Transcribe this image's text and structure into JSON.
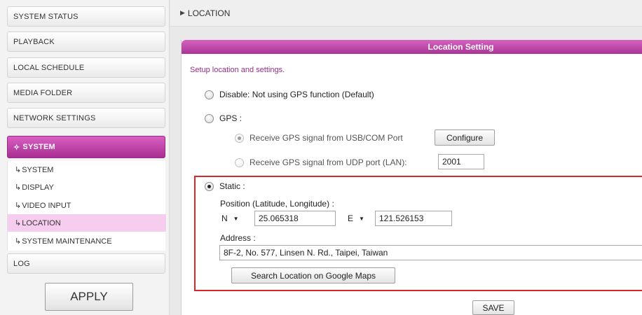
{
  "sidebar": {
    "items": [
      {
        "label": "SYSTEM STATUS"
      },
      {
        "label": "PLAYBACK"
      },
      {
        "label": "LOCAL SCHEDULE"
      },
      {
        "label": "MEDIA FOLDER"
      },
      {
        "label": "NETWORK SETTINGS"
      },
      {
        "label": "SYSTEM",
        "active": true
      },
      {
        "label": "LOG"
      }
    ],
    "submenu": [
      {
        "label": "SYSTEM"
      },
      {
        "label": "DISPLAY"
      },
      {
        "label": "VIDEO INPUT"
      },
      {
        "label": "LOCATION",
        "active": true
      },
      {
        "label": "SYSTEM MAINTENANCE"
      }
    ],
    "sub_arrow": "↳",
    "active_icon": "✧",
    "apply_label": "APPLY"
  },
  "header": {
    "arrow": "▶",
    "title": "LOCATION"
  },
  "panel": {
    "title": "Location Setting",
    "description": "Setup location and settings.",
    "options": {
      "disable_label": "Disable: Not using GPS function (Default)",
      "gps_label": "GPS :",
      "gps_usb_label": "Receive GPS signal from USB/COM Port",
      "configure_label": "Configure",
      "gps_udp_label": "Receive GPS signal from UDP port (LAN):",
      "udp_port_value": "2001",
      "static_label": "Static :"
    },
    "static": {
      "position_label": "Position (Latitude, Longitude) :",
      "lat_dir": "N",
      "lat_value": "25.065318",
      "lon_dir": "E",
      "lon_value": "121.526153",
      "address_label": "Address :",
      "address_value": "8F-2, No. 577, Linsen N. Rd., Taipei, Taiwan",
      "search_label": "Search Location on Google Maps"
    },
    "save_label": "SAVE"
  },
  "colors": {
    "accent": "#a93496",
    "highlight_box": "#d9262b",
    "submenu_active": "#f6cdee"
  }
}
